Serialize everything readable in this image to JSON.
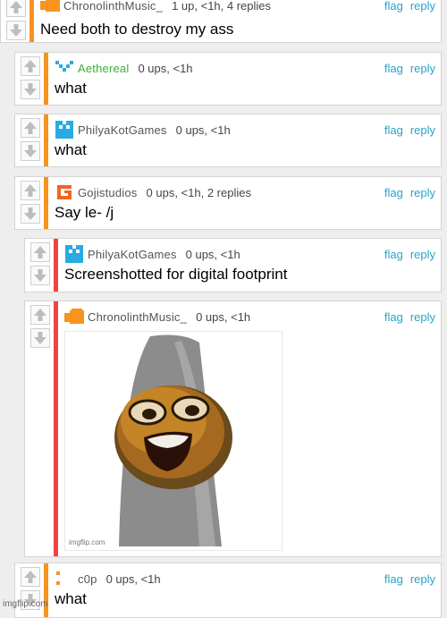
{
  "comments": [
    {
      "username": "ChronolinthMusic_",
      "meta": "1 up, <1h, 4 replies",
      "text": "Need both to destroy my ass"
    },
    {
      "username": "Aethereal",
      "meta": "0 ups, <1h",
      "text": "what"
    },
    {
      "username": "PhilyaKotGames",
      "meta": "0 ups, <1h",
      "text": "what"
    },
    {
      "username": "Gojistudios",
      "meta": "0 ups, <1h, 2 replies",
      "text": "Say le- /j"
    },
    {
      "username": "PhilyaKotGames",
      "meta": "0 ups, <1h",
      "text": "Screenshotted for digital footprint"
    },
    {
      "username": "ChronolinthMusic_",
      "meta": "0 ups, <1h",
      "text": ""
    },
    {
      "username": "c0p",
      "meta": "0 ups, <1h",
      "text": "what"
    }
  ],
  "actions": {
    "flag": "flag",
    "reply": "reply"
  },
  "image": {
    "watermark": "imgflip.com"
  },
  "site_watermark": "imgflip.com",
  "colors": {
    "bar_orange": "#f7931e",
    "bar_red": "#ef4444",
    "link": "#2aa3c8",
    "green_name": "#3cae3c"
  },
  "icons": [
    "up-arrow-icon",
    "down-arrow-icon",
    "avatar-icon"
  ]
}
